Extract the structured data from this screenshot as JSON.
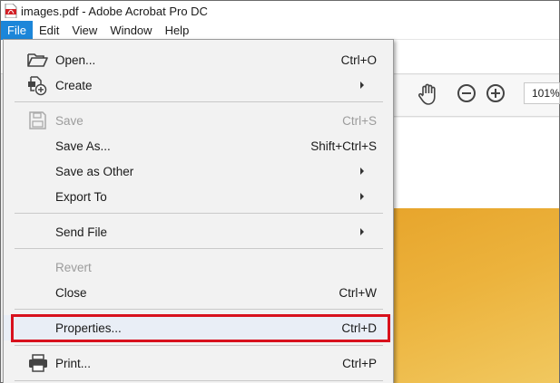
{
  "window": {
    "title": "images.pdf - Adobe Acrobat Pro DC"
  },
  "menubar": {
    "items": [
      {
        "label": "File",
        "active": true
      },
      {
        "label": "Edit"
      },
      {
        "label": "View"
      },
      {
        "label": "Window"
      },
      {
        "label": "Help"
      }
    ]
  },
  "toolbar": {
    "zoom_value": "101%"
  },
  "file_menu": {
    "items": [
      {
        "label": "Open...",
        "shortcut": "Ctrl+O",
        "icon": "open-folder-icon"
      },
      {
        "label": "Create",
        "submenu": true,
        "icon": "create-file-icon"
      },
      {
        "label": "Save",
        "shortcut": "Ctrl+S",
        "disabled": true,
        "icon": "save-icon"
      },
      {
        "label": "Save As...",
        "shortcut": "Shift+Ctrl+S"
      },
      {
        "label": "Save as Other",
        "submenu": true
      },
      {
        "label": "Export To",
        "submenu": true
      },
      {
        "label": "Send File",
        "submenu": true
      },
      {
        "label": "Revert",
        "disabled": true
      },
      {
        "label": "Close",
        "shortcut": "Ctrl+W"
      },
      {
        "label": "Properties...",
        "shortcut": "Ctrl+D",
        "highlighted": true
      },
      {
        "label": "Print...",
        "shortcut": "Ctrl+P",
        "icon": "printer-icon"
      }
    ]
  },
  "colors": {
    "active_menu": "#1c86d9",
    "highlight_border": "#d8111d"
  }
}
